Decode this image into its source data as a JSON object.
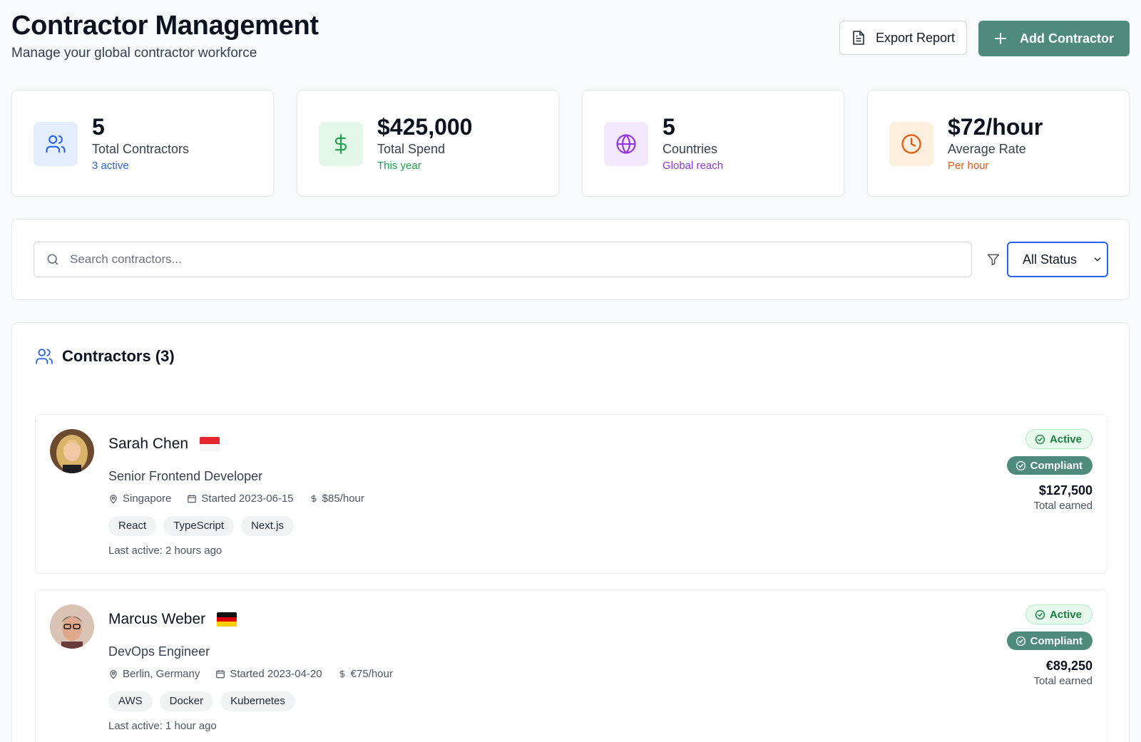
{
  "header": {
    "title": "Contractor Management",
    "subtitle": "Manage your global contractor workforce",
    "export_label": "Export Report",
    "add_label": "Add Contractor"
  },
  "stats": [
    {
      "value": "5",
      "label": "Total Contractors",
      "sub": "3 active",
      "icon": "users-icon",
      "accent": "#2563eb",
      "bg": "#e3edfd"
    },
    {
      "value": "$425,000",
      "label": "Total Spend",
      "sub": "This year",
      "icon": "dollar-icon",
      "accent": "#16a34a",
      "bg": "#e3f7e9"
    },
    {
      "value": "5",
      "label": "Countries",
      "sub": "Global reach",
      "icon": "globe-icon",
      "accent": "#9333ea",
      "bg": "#f3e8fd"
    },
    {
      "value": "$72/hour",
      "label": "Average Rate",
      "sub": "Per hour",
      "icon": "clock-icon",
      "accent": "#ea580c",
      "bg": "#fdeedd"
    }
  ],
  "filters": {
    "search_placeholder": "Search contractors...",
    "status_selected": "All Status"
  },
  "list": {
    "title": "Contractors (3)"
  },
  "contractors": [
    {
      "name": "Sarah Chen",
      "flag": "singapore-flag",
      "role": "Senior Frontend Developer",
      "location": "Singapore",
      "started": "Started 2023-06-15",
      "rate": "$85/hour",
      "tags": [
        "React",
        "TypeScript",
        "Next.js"
      ],
      "last_active": "Last active: 2 hours ago",
      "status": "Active",
      "compliance": "Compliant",
      "earned": "$127,500",
      "earned_label": "Total earned"
    },
    {
      "name": "Marcus Weber",
      "flag": "germany-flag",
      "role": "DevOps Engineer",
      "location": "Berlin, Germany",
      "started": "Started 2023-04-20",
      "rate": "€75/hour",
      "tags": [
        "AWS",
        "Docker",
        "Kubernetes"
      ],
      "last_active": "Last active: 1 hour ago",
      "status": "Active",
      "compliance": "Compliant",
      "earned": "€89,250",
      "earned_label": "Total earned"
    }
  ],
  "colors": {
    "primary": "#4e8b7c",
    "focus": "#2563eb",
    "active_green": "#15803d"
  }
}
